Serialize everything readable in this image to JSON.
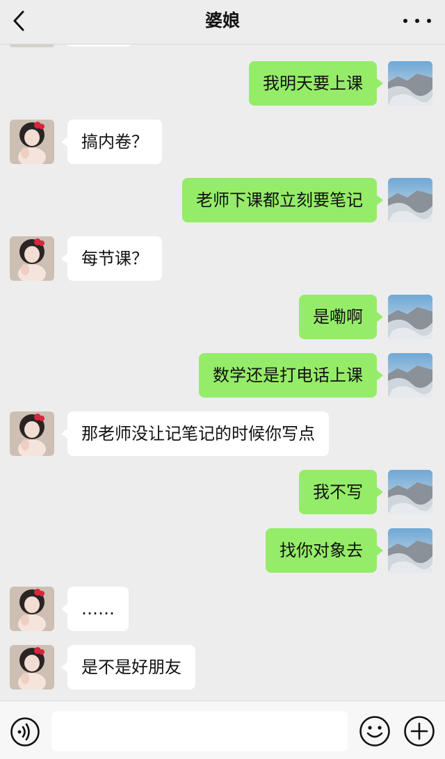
{
  "header": {
    "title": "婆娘"
  },
  "messages": [
    {
      "side": "out",
      "text": "我明天要上课"
    },
    {
      "side": "in",
      "text": "搞内卷？"
    },
    {
      "side": "out",
      "text": "老师下课都立刻要笔记"
    },
    {
      "side": "in",
      "text": "每节课？"
    },
    {
      "side": "out",
      "text": "是嘞啊"
    },
    {
      "side": "out",
      "text": "数学还是打电话上课"
    },
    {
      "side": "in",
      "text": "那老师没让记笔记的时候你写点"
    },
    {
      "side": "out",
      "text": "我不写"
    },
    {
      "side": "out",
      "text": "找你对象去"
    },
    {
      "side": "in",
      "text": "……"
    },
    {
      "side": "in",
      "text": "是不是好朋友"
    }
  ],
  "input": {
    "value": ""
  },
  "colors": {
    "background": "#ededed",
    "outgoing_bubble": "#95ec69",
    "incoming_bubble": "#ffffff"
  },
  "icons": {
    "back": "back-chevron-icon",
    "more": "more-dots-icon",
    "voice": "voice-input-icon",
    "emoji": "emoji-icon",
    "plus": "plus-icon"
  }
}
